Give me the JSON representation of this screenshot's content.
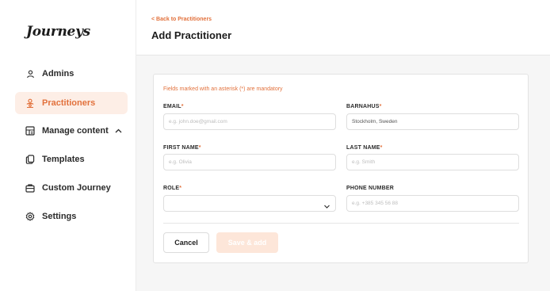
{
  "app": {
    "logo": "Journeys"
  },
  "sidebar": {
    "items": [
      {
        "label": "Admins",
        "icon": "user-icon"
      },
      {
        "label": "Practitioners",
        "icon": "users-icon",
        "active": true
      },
      {
        "label": "Manage content",
        "icon": "content-icon",
        "expandable": true
      },
      {
        "label": "Templates",
        "icon": "copy-icon"
      },
      {
        "label": "Custom Journey",
        "icon": "briefcase-icon"
      },
      {
        "label": "Settings",
        "icon": "gear-icon"
      }
    ]
  },
  "header": {
    "back_label": "< Back to Practitioners",
    "title": "Add Practitioner"
  },
  "form": {
    "mandatory_note": "Fields marked with an asterisk (*) are mandatory",
    "email": {
      "label": "EMAIL",
      "required": "*",
      "placeholder": "e.g. john.doe@gmail.com",
      "value": ""
    },
    "barnahus": {
      "label": "BARNAHUS",
      "required": "*",
      "placeholder": "",
      "value": "Stockholm, Sweden"
    },
    "first_name": {
      "label": "FIRST NAME",
      "required": "*",
      "placeholder": "e.g. Olivia",
      "value": ""
    },
    "last_name": {
      "label": "LAST NAME",
      "required": "*",
      "placeholder": "e.g. Smith",
      "value": ""
    },
    "role": {
      "label": "ROLE",
      "required": "*",
      "value": ""
    },
    "phone": {
      "label": "PHONE NUMBER",
      "placeholder": "e.g. +385 345 56 88",
      "value": ""
    },
    "cancel_label": "Cancel",
    "save_label": "Save & add"
  },
  "colors": {
    "accent": "#e2713c",
    "accent_light": "#fdeee6",
    "background": "#f6f6f6"
  }
}
